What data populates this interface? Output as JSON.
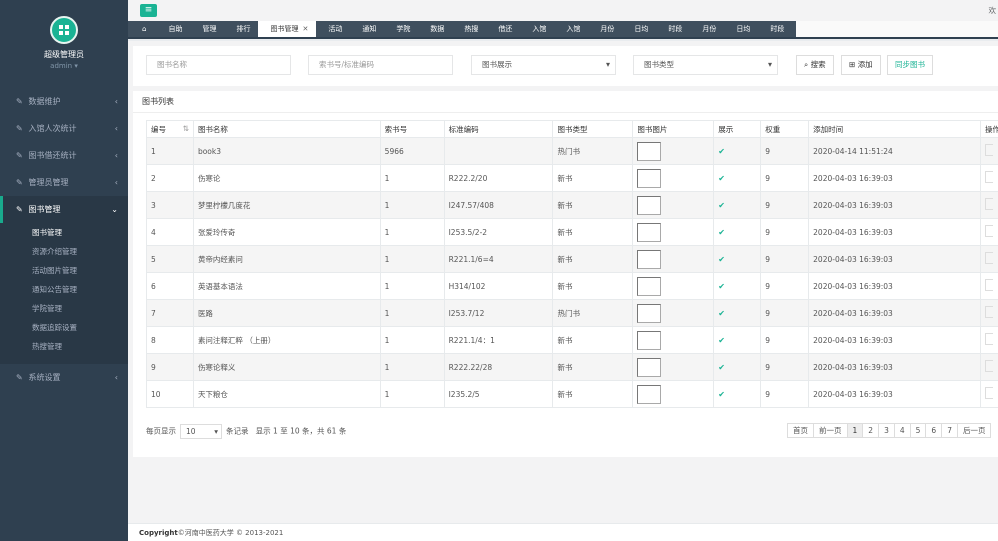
{
  "sidebar": {
    "user_name": "超级管理员",
    "user_role": "admin ▾",
    "menu": [
      {
        "label": "数据维护",
        "icon": "edit-icon"
      },
      {
        "label": "入馆人次统计",
        "icon": "edit-icon"
      },
      {
        "label": "图书借还统计",
        "icon": "edit-icon"
      },
      {
        "label": "管理员管理",
        "icon": "edit-icon"
      },
      {
        "label": "图书管理",
        "icon": "edit-icon"
      }
    ],
    "submenu": [
      "图书管理",
      "资源介绍管理",
      "活动图片管理",
      "通知公告管理",
      "学院管理",
      "数据追踪设置",
      "热搜管理"
    ],
    "last_menu": {
      "label": "系统设置",
      "icon": "edit-icon"
    }
  },
  "topbar": {
    "welcome": "欢"
  },
  "tabs": [
    "自助",
    "管理",
    "排行",
    "图书管理",
    "活动",
    "通知",
    "学院",
    "数据",
    "热搜",
    "借还",
    "入馆",
    "入馆",
    "月份",
    "日均",
    "时段",
    "月份",
    "日均",
    "时段"
  ],
  "search": {
    "name_placeholder": "图书名称",
    "code_placeholder": "索书号/标准编码",
    "display_select": "图书展示",
    "type_select": "图书类型",
    "search_btn": "搜索",
    "add_btn": "添加",
    "sync_btn": "同步图书"
  },
  "list": {
    "title": "图书列表",
    "headers": [
      "编号",
      "图书名称",
      "索书号",
      "标准编码",
      "图书类型",
      "图书图片",
      "展示",
      "权重",
      "添加时间",
      "操作"
    ],
    "rows": [
      {
        "id": "1",
        "name": "book3",
        "call": "5966",
        "code": "",
        "type": "热门书",
        "time": "2020-04-14 11:51:24"
      },
      {
        "id": "2",
        "name": "伤寒论",
        "call": "1",
        "code": "R222.2/20",
        "type": "新书",
        "time": "2020-04-03 16:39:03"
      },
      {
        "id": "3",
        "name": "梦里柠檬几度花",
        "call": "1",
        "code": "I247.57/408",
        "type": "新书",
        "time": "2020-04-03 16:39:03"
      },
      {
        "id": "4",
        "name": "张爱玲传奇",
        "call": "1",
        "code": "I253.5/2-2",
        "type": "新书",
        "time": "2020-04-03 16:39:03"
      },
      {
        "id": "5",
        "name": "黄帝内经素问",
        "call": "1",
        "code": "R221.1/6=4",
        "type": "新书",
        "time": "2020-04-03 16:39:03"
      },
      {
        "id": "6",
        "name": "英语基本语法",
        "call": "1",
        "code": "H314/102",
        "type": "新书",
        "time": "2020-04-03 16:39:03"
      },
      {
        "id": "7",
        "name": "医路",
        "call": "1",
        "code": "I253.7/12",
        "type": "热门书",
        "time": "2020-04-03 16:39:03"
      },
      {
        "id": "8",
        "name": "素问注释汇粹 （上册）",
        "call": "1",
        "code": "R221.1/4：1",
        "type": "新书",
        "time": "2020-04-03 16:39:03"
      },
      {
        "id": "9",
        "name": "伤寒论释义",
        "call": "1",
        "code": "R222.22/28",
        "type": "新书",
        "time": "2020-04-03 16:39:03"
      },
      {
        "id": "10",
        "name": "天下粮仓",
        "call": "1",
        "code": "I235.2/5",
        "type": "新书",
        "time": "2020-04-03 16:39:03"
      }
    ],
    "weight": "9",
    "check": "✔"
  },
  "pager": {
    "per_page_label": "每页显示",
    "per_page_value": "10",
    "records_label": "条记录",
    "summary": "显示 1 至 10 条，共 61 条",
    "first": "首页",
    "prev": "前一页",
    "pages": [
      "1",
      "2",
      "3",
      "4",
      "5",
      "6",
      "7"
    ],
    "next": "后一页"
  },
  "footer": {
    "brand": "Copyright",
    "text": "©河南中医药大学 © 2013-2021"
  }
}
